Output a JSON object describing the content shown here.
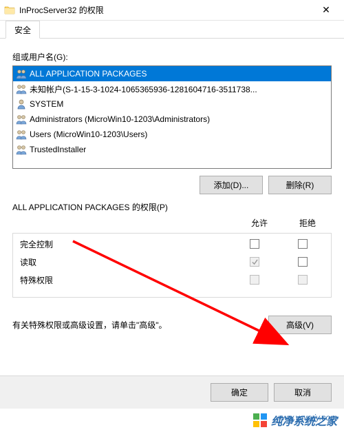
{
  "window": {
    "title": "InProcServer32 的权限",
    "close_glyph": "✕"
  },
  "tab": {
    "security": "安全"
  },
  "groups_label": "组或用户名(G):",
  "principals": [
    {
      "name": "ALL APPLICATION PACKAGES",
      "selected": true
    },
    {
      "name": "未知帐户(S-1-15-3-1024-1065365936-1281604716-3511738...",
      "selected": false
    },
    {
      "name": "SYSTEM",
      "selected": false
    },
    {
      "name": "Administrators (MicroWin10-1203\\Administrators)",
      "selected": false
    },
    {
      "name": "Users (MicroWin10-1203\\Users)",
      "selected": false
    },
    {
      "name": "TrustedInstaller",
      "selected": false
    }
  ],
  "buttons": {
    "add": "添加(D)...",
    "remove": "删除(R)",
    "advanced": "高级(V)",
    "ok": "确定",
    "cancel": "取消"
  },
  "perm_section": {
    "label": "ALL APPLICATION PACKAGES 的权限(P)",
    "col_allow": "允许",
    "col_deny": "拒绝",
    "rows": [
      {
        "name": "完全控制",
        "allow": false,
        "deny": false,
        "allow_disabled": false,
        "deny_disabled": false
      },
      {
        "name": "读取",
        "allow": true,
        "deny": false,
        "allow_disabled": true,
        "deny_disabled": false
      },
      {
        "name": "特殊权限",
        "allow": false,
        "deny": false,
        "allow_disabled": true,
        "deny_disabled": true
      }
    ]
  },
  "advanced_text": "有关特殊权限或高级设置，请单击\"高级\"。",
  "watermark": {
    "text": "纯净系统之家",
    "url": "www.ycwxjy.com"
  }
}
